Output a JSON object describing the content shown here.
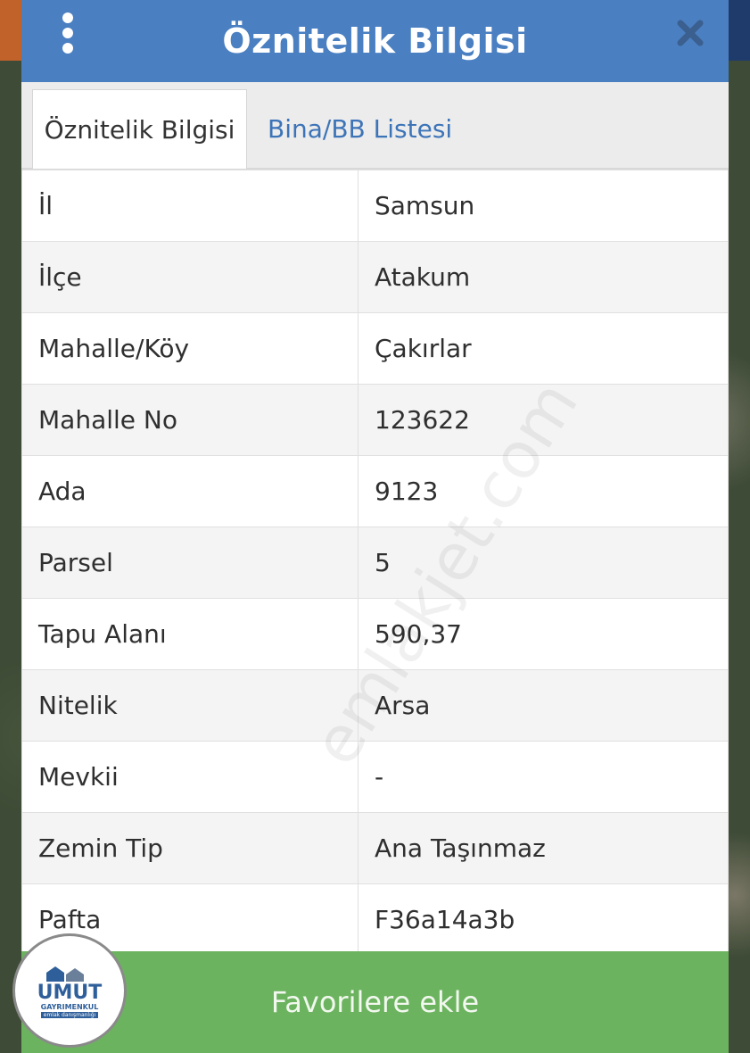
{
  "dialog": {
    "title": "Öznitelik Bilgisi",
    "menu_icon": "more-vertical-icon",
    "close_icon": "close-icon"
  },
  "tabs": [
    {
      "label": "Öznitelik Bilgisi",
      "active": true
    },
    {
      "label": "Bina/BB Listesi",
      "active": false
    }
  ],
  "attributes": [
    {
      "key": "İl",
      "value": "Samsun"
    },
    {
      "key": "İlçe",
      "value": "Atakum"
    },
    {
      "key": "Mahalle/Köy",
      "value": "Çakırlar"
    },
    {
      "key": "Mahalle No",
      "value": "123622"
    },
    {
      "key": "Ada",
      "value": "9123"
    },
    {
      "key": "Parsel",
      "value": "5"
    },
    {
      "key": "Tapu Alanı",
      "value": "590,37"
    },
    {
      "key": "Nitelik",
      "value": "Arsa"
    },
    {
      "key": "Mevkii",
      "value": "-"
    },
    {
      "key": "Zemin Tip",
      "value": "Ana Taşınmaz"
    },
    {
      "key": "Pafta",
      "value": "F36a14a3b"
    }
  ],
  "favorite_button": {
    "label": "Favorilere ekle"
  },
  "watermark": "emlakjet.com",
  "logo": {
    "name": "UMUT",
    "line2": "GAYRIMENKUL",
    "line3": "emlak danışmanlığı"
  },
  "colors": {
    "header": "#4a7fc1",
    "tab_link": "#3d74b8",
    "favorite_button": "#6cb35f"
  }
}
